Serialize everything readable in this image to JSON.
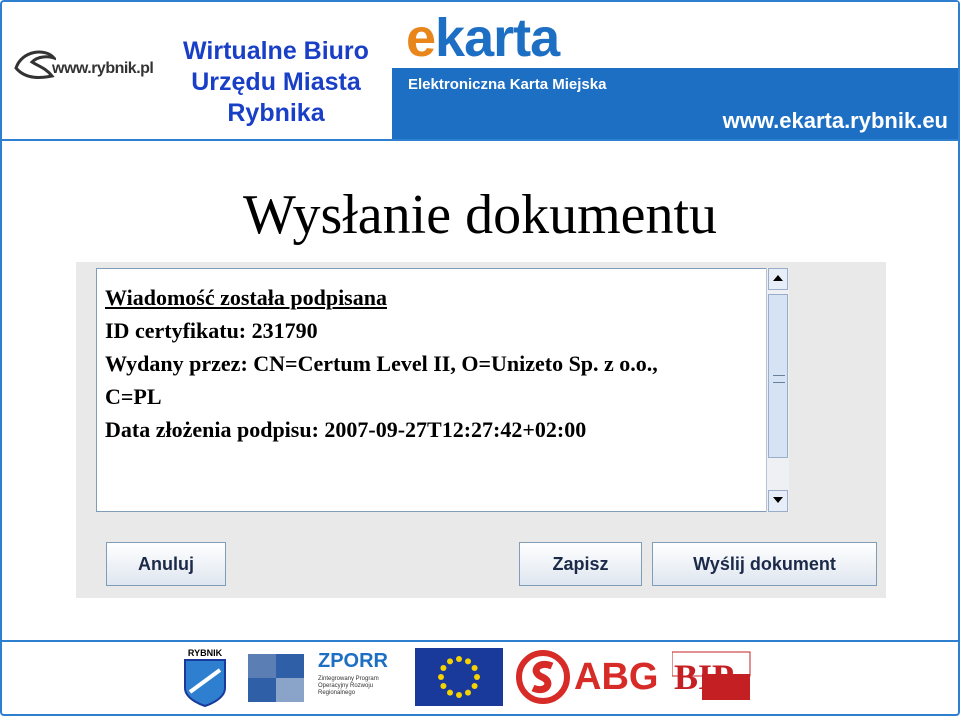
{
  "header": {
    "rybnik_logo_text": "www.rybnik.pl",
    "title_line1": "Wirtualne Biuro",
    "title_line2": "Urzędu Miasta",
    "title_line3": "Rybnika",
    "ekarta_logo_e": "e",
    "ekarta_logo_rest": "karta",
    "ekarta_subtitle": "Elektroniczna Karta Miejska",
    "ekarta_url": "www.ekarta.rybnik.eu"
  },
  "page_title": "Wysłanie dokumentu",
  "message": {
    "line1": "Wiadomość została podpisana",
    "line2": "ID certyfikatu: 231790",
    "line3": "Wydany przez: CN=Certum Level II, O=Unizeto Sp. z o.o.,",
    "line4": "C=PL",
    "line5": "Data złożenia podpisu: 2007-09-27T12:27:42+02:00"
  },
  "buttons": {
    "cancel": "Anuluj",
    "save": "Zapisz",
    "send": "Wyślij dokument"
  },
  "footer": {
    "crest_caption": "RYBNIK",
    "zporr_title": "ZPORR",
    "zporr_subtitle": "Zintegrowany Program Operacyjny Rozwoju Regionalnego",
    "abg_text": "ABG",
    "bip_text": "BIP"
  },
  "colors": {
    "accent_blue": "#1d6fc4",
    "title_blue": "#1a3fc7",
    "ekarta_orange": "#e8851b",
    "abg_red": "#d72b27"
  }
}
